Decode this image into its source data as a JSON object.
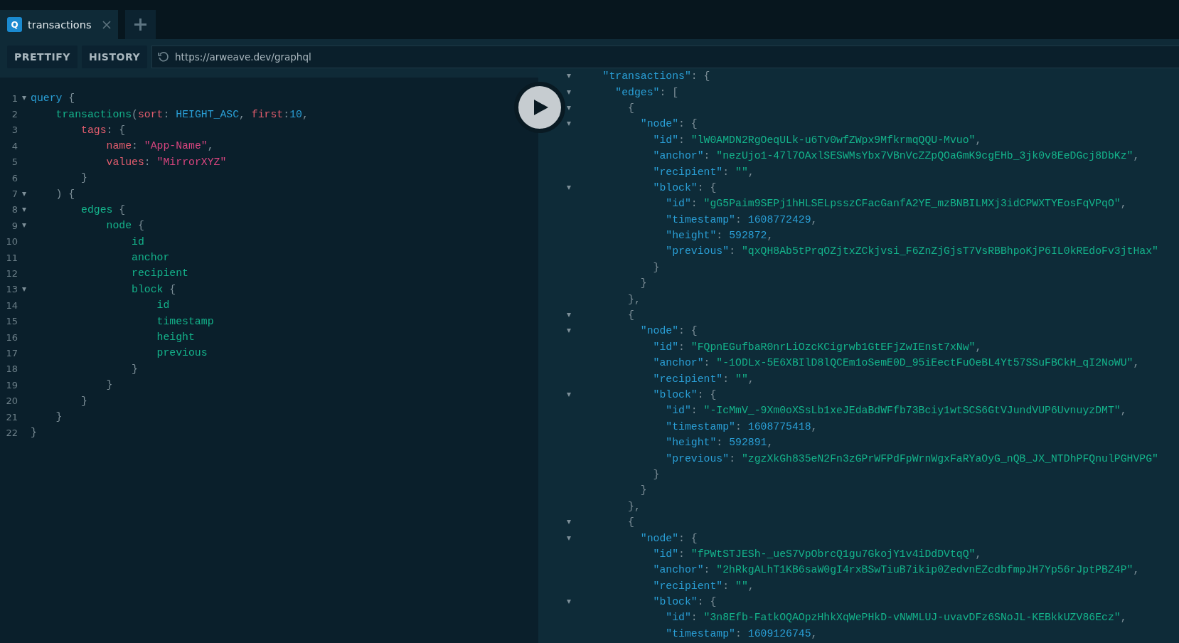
{
  "tabs": [
    {
      "icon_letter": "Q",
      "label": "transactions",
      "selected": true
    }
  ],
  "toolbar": {
    "buttons": [
      "PRETTIFY",
      "HISTORY"
    ],
    "url": "https://arweave.dev/graphql"
  },
  "query_editor": {
    "lines": [
      {
        "number": "1",
        "foldable": true,
        "tokens": [
          {
            "kind": "keyword",
            "text": "query"
          },
          {
            "kind": "punct",
            "text": " {"
          }
        ]
      },
      {
        "number": "2",
        "foldable": false,
        "tokens": [
          {
            "kind": "field",
            "text": "    transactions"
          },
          {
            "kind": "punct",
            "text": "("
          },
          {
            "kind": "arg",
            "text": "sort"
          },
          {
            "kind": "punct",
            "text": ": "
          },
          {
            "kind": "enum",
            "text": "HEIGHT_ASC"
          },
          {
            "kind": "punct",
            "text": ", "
          },
          {
            "kind": "arg",
            "text": "first"
          },
          {
            "kind": "punct",
            "text": ":"
          },
          {
            "kind": "number",
            "text": "10"
          },
          {
            "kind": "punct",
            "text": ","
          }
        ]
      },
      {
        "number": "3",
        "foldable": false,
        "tokens": [
          {
            "kind": "arg",
            "text": "        tags"
          },
          {
            "kind": "punct",
            "text": ": {"
          }
        ]
      },
      {
        "number": "4",
        "foldable": false,
        "tokens": [
          {
            "kind": "arg",
            "text": "            name"
          },
          {
            "kind": "punct",
            "text": ": "
          },
          {
            "kind": "string",
            "text": "\"App-Name\""
          },
          {
            "kind": "punct",
            "text": ","
          }
        ]
      },
      {
        "number": "5",
        "foldable": false,
        "tokens": [
          {
            "kind": "arg",
            "text": "            values"
          },
          {
            "kind": "punct",
            "text": ": "
          },
          {
            "kind": "string",
            "text": "\"MirrorXYZ\""
          }
        ]
      },
      {
        "number": "6",
        "foldable": false,
        "tokens": [
          {
            "kind": "punct",
            "text": "        }"
          }
        ]
      },
      {
        "number": "7",
        "foldable": true,
        "tokens": [
          {
            "kind": "punct",
            "text": "    ) {"
          }
        ]
      },
      {
        "number": "8",
        "foldable": true,
        "tokens": [
          {
            "kind": "field",
            "text": "        edges"
          },
          {
            "kind": "punct",
            "text": " {"
          }
        ]
      },
      {
        "number": "9",
        "foldable": true,
        "tokens": [
          {
            "kind": "field",
            "text": "            node"
          },
          {
            "kind": "punct",
            "text": " {"
          }
        ]
      },
      {
        "number": "10",
        "foldable": false,
        "tokens": [
          {
            "kind": "field",
            "text": "                id"
          }
        ]
      },
      {
        "number": "11",
        "foldable": false,
        "tokens": [
          {
            "kind": "field",
            "text": "                anchor"
          }
        ]
      },
      {
        "number": "12",
        "foldable": false,
        "tokens": [
          {
            "kind": "field",
            "text": "                recipient"
          }
        ]
      },
      {
        "number": "13",
        "foldable": true,
        "tokens": [
          {
            "kind": "field",
            "text": "                block"
          },
          {
            "kind": "punct",
            "text": " {"
          }
        ]
      },
      {
        "number": "14",
        "foldable": false,
        "tokens": [
          {
            "kind": "field",
            "text": "                    id"
          }
        ]
      },
      {
        "number": "15",
        "foldable": false,
        "tokens": [
          {
            "kind": "field",
            "text": "                    timestamp"
          }
        ]
      },
      {
        "number": "16",
        "foldable": false,
        "tokens": [
          {
            "kind": "field",
            "text": "                    height"
          }
        ]
      },
      {
        "number": "17",
        "foldable": false,
        "tokens": [
          {
            "kind": "field",
            "text": "                    previous"
          }
        ]
      },
      {
        "number": "18",
        "foldable": false,
        "tokens": [
          {
            "kind": "punct",
            "text": "                }"
          }
        ]
      },
      {
        "number": "19",
        "foldable": false,
        "tokens": [
          {
            "kind": "punct",
            "text": "            }"
          }
        ]
      },
      {
        "number": "20",
        "foldable": false,
        "tokens": [
          {
            "kind": "punct",
            "text": "        }"
          }
        ]
      },
      {
        "number": "21",
        "foldable": false,
        "tokens": [
          {
            "kind": "punct",
            "text": "    }"
          }
        ]
      },
      {
        "number": "22",
        "foldable": false,
        "tokens": [
          {
            "kind": "punct",
            "text": "}"
          }
        ]
      }
    ]
  },
  "result_viewer": {
    "lines": [
      {
        "foldable": true,
        "tokens": [
          {
            "kind": "key",
            "text": "    \"transactions\""
          },
          {
            "kind": "punct",
            "text": ": {"
          }
        ]
      },
      {
        "foldable": true,
        "tokens": [
          {
            "kind": "key",
            "text": "      \"edges\""
          },
          {
            "kind": "punct",
            "text": ": ["
          }
        ]
      },
      {
        "foldable": true,
        "tokens": [
          {
            "kind": "punct",
            "text": "        {"
          }
        ]
      },
      {
        "foldable": true,
        "tokens": [
          {
            "kind": "key",
            "text": "          \"node\""
          },
          {
            "kind": "punct",
            "text": ": {"
          }
        ]
      },
      {
        "foldable": false,
        "tokens": [
          {
            "kind": "key",
            "text": "            \"id\""
          },
          {
            "kind": "punct",
            "text": ": "
          },
          {
            "kind": "string",
            "text": "\"lW0AMDN2RgOeqULk-u6Tv0wfZWpx9MfkrmqQQU-Mvuo\""
          },
          {
            "kind": "punct",
            "text": ","
          }
        ]
      },
      {
        "foldable": false,
        "tokens": [
          {
            "kind": "key",
            "text": "            \"anchor\""
          },
          {
            "kind": "punct",
            "text": ": "
          },
          {
            "kind": "string",
            "text": "\"nezUjo1-47l7OAxlSESWMsYbx7VBnVcZZpQOaGmK9cgEHb_3jk0v8EeDGcj8DbKz\""
          },
          {
            "kind": "punct",
            "text": ","
          }
        ]
      },
      {
        "foldable": false,
        "tokens": [
          {
            "kind": "key",
            "text": "            \"recipient\""
          },
          {
            "kind": "punct",
            "text": ": "
          },
          {
            "kind": "string",
            "text": "\"\""
          },
          {
            "kind": "punct",
            "text": ","
          }
        ]
      },
      {
        "foldable": true,
        "tokens": [
          {
            "kind": "key",
            "text": "            \"block\""
          },
          {
            "kind": "punct",
            "text": ": {"
          }
        ]
      },
      {
        "foldable": false,
        "tokens": [
          {
            "kind": "key",
            "text": "              \"id\""
          },
          {
            "kind": "punct",
            "text": ": "
          },
          {
            "kind": "string",
            "text": "\"gG5Paim9SEPj1hHLSELpsszCFacGanfA2YE_mzBNBILMXj3idCPWXTYEosFqVPqO\""
          },
          {
            "kind": "punct",
            "text": ","
          }
        ]
      },
      {
        "foldable": false,
        "tokens": [
          {
            "kind": "key",
            "text": "              \"timestamp\""
          },
          {
            "kind": "punct",
            "text": ": "
          },
          {
            "kind": "number",
            "text": "1608772429"
          },
          {
            "kind": "punct",
            "text": ","
          }
        ]
      },
      {
        "foldable": false,
        "tokens": [
          {
            "kind": "key",
            "text": "              \"height\""
          },
          {
            "kind": "punct",
            "text": ": "
          },
          {
            "kind": "number",
            "text": "592872"
          },
          {
            "kind": "punct",
            "text": ","
          }
        ]
      },
      {
        "foldable": false,
        "tokens": [
          {
            "kind": "key",
            "text": "              \"previous\""
          },
          {
            "kind": "punct",
            "text": ": "
          },
          {
            "kind": "string",
            "text": "\"qxQH8Ab5tPrqOZjtxZCkjvsi_F6ZnZjGjsT7VsRBBhpoKjP6IL0kREdoFv3jtHax\""
          }
        ]
      },
      {
        "foldable": false,
        "tokens": [
          {
            "kind": "punct",
            "text": "            }"
          }
        ]
      },
      {
        "foldable": false,
        "tokens": [
          {
            "kind": "punct",
            "text": "          }"
          }
        ]
      },
      {
        "foldable": false,
        "tokens": [
          {
            "kind": "punct",
            "text": "        },"
          }
        ]
      },
      {
        "foldable": true,
        "tokens": [
          {
            "kind": "punct",
            "text": "        {"
          }
        ]
      },
      {
        "foldable": true,
        "tokens": [
          {
            "kind": "key",
            "text": "          \"node\""
          },
          {
            "kind": "punct",
            "text": ": {"
          }
        ]
      },
      {
        "foldable": false,
        "tokens": [
          {
            "kind": "key",
            "text": "            \"id\""
          },
          {
            "kind": "punct",
            "text": ": "
          },
          {
            "kind": "string",
            "text": "\"FQpnEGufbaR0nrLiOzcKCigrwb1GtEFjZwIEnst7xNw\""
          },
          {
            "kind": "punct",
            "text": ","
          }
        ]
      },
      {
        "foldable": false,
        "tokens": [
          {
            "kind": "key",
            "text": "            \"anchor\""
          },
          {
            "kind": "punct",
            "text": ": "
          },
          {
            "kind": "string",
            "text": "\"-1ODLx-5E6XBIlD8lQCEm1oSemE0D_95iEectFuOeBL4Yt57SSuFBCkH_qI2NoWU\""
          },
          {
            "kind": "punct",
            "text": ","
          }
        ]
      },
      {
        "foldable": false,
        "tokens": [
          {
            "kind": "key",
            "text": "            \"recipient\""
          },
          {
            "kind": "punct",
            "text": ": "
          },
          {
            "kind": "string",
            "text": "\"\""
          },
          {
            "kind": "punct",
            "text": ","
          }
        ]
      },
      {
        "foldable": true,
        "tokens": [
          {
            "kind": "key",
            "text": "            \"block\""
          },
          {
            "kind": "punct",
            "text": ": {"
          }
        ]
      },
      {
        "foldable": false,
        "tokens": [
          {
            "kind": "key",
            "text": "              \"id\""
          },
          {
            "kind": "punct",
            "text": ": "
          },
          {
            "kind": "string",
            "text": "\"-IcMmV_-9Xm0oXSsLb1xeJEdaBdWFfb73Bciy1wtSCS6GtVJundVUP6UvnuyzDMT\""
          },
          {
            "kind": "punct",
            "text": ","
          }
        ]
      },
      {
        "foldable": false,
        "tokens": [
          {
            "kind": "key",
            "text": "              \"timestamp\""
          },
          {
            "kind": "punct",
            "text": ": "
          },
          {
            "kind": "number",
            "text": "1608775418"
          },
          {
            "kind": "punct",
            "text": ","
          }
        ]
      },
      {
        "foldable": false,
        "tokens": [
          {
            "kind": "key",
            "text": "              \"height\""
          },
          {
            "kind": "punct",
            "text": ": "
          },
          {
            "kind": "number",
            "text": "592891"
          },
          {
            "kind": "punct",
            "text": ","
          }
        ]
      },
      {
        "foldable": false,
        "tokens": [
          {
            "kind": "key",
            "text": "              \"previous\""
          },
          {
            "kind": "punct",
            "text": ": "
          },
          {
            "kind": "string",
            "text": "\"zgzXkGh835eN2Fn3zGPrWFPdFpWrnWgxFaRYaOyG_nQB_JX_NTDhPFQnulPGHVPG\""
          }
        ]
      },
      {
        "foldable": false,
        "tokens": [
          {
            "kind": "punct",
            "text": "            }"
          }
        ]
      },
      {
        "foldable": false,
        "tokens": [
          {
            "kind": "punct",
            "text": "          }"
          }
        ]
      },
      {
        "foldable": false,
        "tokens": [
          {
            "kind": "punct",
            "text": "        },"
          }
        ]
      },
      {
        "foldable": true,
        "tokens": [
          {
            "kind": "punct",
            "text": "        {"
          }
        ]
      },
      {
        "foldable": true,
        "tokens": [
          {
            "kind": "key",
            "text": "          \"node\""
          },
          {
            "kind": "punct",
            "text": ": {"
          }
        ]
      },
      {
        "foldable": false,
        "tokens": [
          {
            "kind": "key",
            "text": "            \"id\""
          },
          {
            "kind": "punct",
            "text": ": "
          },
          {
            "kind": "string",
            "text": "\"fPWtSTJESh-_ueS7VpObrcQ1gu7GkojY1v4iDdDVtqQ\""
          },
          {
            "kind": "punct",
            "text": ","
          }
        ]
      },
      {
        "foldable": false,
        "tokens": [
          {
            "kind": "key",
            "text": "            \"anchor\""
          },
          {
            "kind": "punct",
            "text": ": "
          },
          {
            "kind": "string",
            "text": "\"2hRkgALhT1KB6saW0gI4rxBSwTiuB7ikip0ZedvnEZcdbfmpJH7Yp56rJptPBZ4P\""
          },
          {
            "kind": "punct",
            "text": ","
          }
        ]
      },
      {
        "foldable": false,
        "tokens": [
          {
            "kind": "key",
            "text": "            \"recipient\""
          },
          {
            "kind": "punct",
            "text": ": "
          },
          {
            "kind": "string",
            "text": "\"\""
          },
          {
            "kind": "punct",
            "text": ","
          }
        ]
      },
      {
        "foldable": true,
        "tokens": [
          {
            "kind": "key",
            "text": "            \"block\""
          },
          {
            "kind": "punct",
            "text": ": {"
          }
        ]
      },
      {
        "foldable": false,
        "tokens": [
          {
            "kind": "key",
            "text": "              \"id\""
          },
          {
            "kind": "punct",
            "text": ": "
          },
          {
            "kind": "string",
            "text": "\"3n8Efb-FatkOQAOpzHhkXqWePHkD-vNWMLUJ-uvavDFz6SNoJL-KEBkkUZV86Ecz\""
          },
          {
            "kind": "punct",
            "text": ","
          }
        ]
      },
      {
        "foldable": false,
        "tokens": [
          {
            "kind": "key",
            "text": "              \"timestamp\""
          },
          {
            "kind": "punct",
            "text": ": "
          },
          {
            "kind": "number",
            "text": "1609126745"
          },
          {
            "kind": "punct",
            "text": ","
          }
        ]
      }
    ]
  }
}
